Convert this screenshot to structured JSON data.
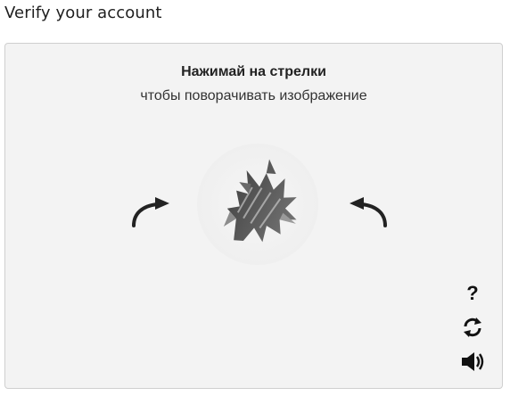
{
  "page": {
    "title": "Verify your account"
  },
  "captcha": {
    "heading": "Нажимай на стрелки",
    "subheading": "чтобы поворачивать изображение",
    "controls": {
      "help_label": "?"
    },
    "icons": {
      "rotate_left": "rotate-left-arrow",
      "rotate_right": "rotate-right-arrow",
      "reload": "refresh-icon",
      "audio": "speaker-icon"
    },
    "colors": {
      "panel_bg": "#f3f3f3",
      "border": "#cfcfcf",
      "arrow": "#222222"
    }
  }
}
